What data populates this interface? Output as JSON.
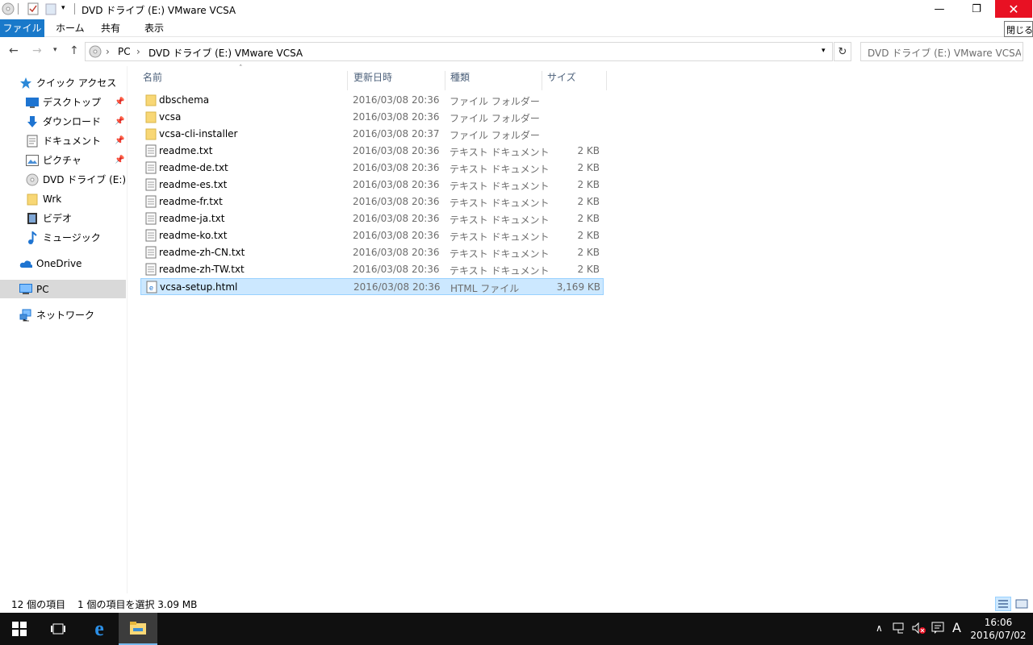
{
  "window": {
    "title": "DVD ドライブ (E:) VMware VCSA",
    "close_tooltip": "閉じる",
    "minimize_glyph": "—",
    "restore_glyph": "❐",
    "close_glyph": "✕"
  },
  "ribbon": {
    "tabs": [
      "ファイル",
      "ホーム",
      "共有",
      "表示"
    ]
  },
  "address": {
    "crumbs": [
      "PC",
      "DVD ドライブ (E:) VMware VCSA"
    ]
  },
  "search": {
    "placeholder": "DVD ドライブ (E:) VMware VCSA..."
  },
  "sidebar": {
    "items": [
      {
        "label": "クイック アクセス",
        "icon": "star-icon"
      },
      {
        "label": "デスクトップ",
        "icon": "desktop-icon",
        "pinned": true
      },
      {
        "label": "ダウンロード",
        "icon": "download-icon",
        "pinned": true
      },
      {
        "label": "ドキュメント",
        "icon": "document-icon",
        "pinned": true
      },
      {
        "label": "ピクチャ",
        "icon": "picture-icon",
        "pinned": true
      },
      {
        "label": "DVD ドライブ (E:) VMware VCSA",
        "icon": "dvd-icon"
      },
      {
        "label": "Wrk",
        "icon": "folder-icon"
      },
      {
        "label": "ビデオ",
        "icon": "video-icon"
      },
      {
        "label": "ミュージック",
        "icon": "music-icon"
      },
      {
        "label": "OneDrive",
        "icon": "cloud-icon"
      },
      {
        "label": "PC",
        "icon": "pc-icon",
        "selected": true
      },
      {
        "label": "ネットワーク",
        "icon": "network-icon"
      }
    ]
  },
  "columns": [
    "名前",
    "更新日時",
    "種類",
    "サイズ"
  ],
  "files": [
    {
      "name": "dbschema",
      "date": "2016/03/08 20:36",
      "type": "ファイル フォルダー",
      "size": "",
      "kind": "folder"
    },
    {
      "name": "vcsa",
      "date": "2016/03/08 20:36",
      "type": "ファイル フォルダー",
      "size": "",
      "kind": "folder"
    },
    {
      "name": "vcsa-cli-installer",
      "date": "2016/03/08 20:37",
      "type": "ファイル フォルダー",
      "size": "",
      "kind": "folder"
    },
    {
      "name": "readme.txt",
      "date": "2016/03/08 20:36",
      "type": "テキスト ドキュメント",
      "size": "2 KB",
      "kind": "txt"
    },
    {
      "name": "readme-de.txt",
      "date": "2016/03/08 20:36",
      "type": "テキスト ドキュメント",
      "size": "2 KB",
      "kind": "txt"
    },
    {
      "name": "readme-es.txt",
      "date": "2016/03/08 20:36",
      "type": "テキスト ドキュメント",
      "size": "2 KB",
      "kind": "txt"
    },
    {
      "name": "readme-fr.txt",
      "date": "2016/03/08 20:36",
      "type": "テキスト ドキュメント",
      "size": "2 KB",
      "kind": "txt"
    },
    {
      "name": "readme-ja.txt",
      "date": "2016/03/08 20:36",
      "type": "テキスト ドキュメント",
      "size": "2 KB",
      "kind": "txt"
    },
    {
      "name": "readme-ko.txt",
      "date": "2016/03/08 20:36",
      "type": "テキスト ドキュメント",
      "size": "2 KB",
      "kind": "txt"
    },
    {
      "name": "readme-zh-CN.txt",
      "date": "2016/03/08 20:36",
      "type": "テキスト ドキュメント",
      "size": "2 KB",
      "kind": "txt"
    },
    {
      "name": "readme-zh-TW.txt",
      "date": "2016/03/08 20:36",
      "type": "テキスト ドキュメント",
      "size": "2 KB",
      "kind": "txt"
    },
    {
      "name": "vcsa-setup.html",
      "date": "2016/03/08 20:36",
      "type": "HTML ファイル",
      "size": "3,169 KB",
      "kind": "html",
      "selected": true
    }
  ],
  "status": {
    "item_count": "12 個の項目",
    "selection": "1 個の項目を選択  3.09 MB"
  },
  "taskbar": {
    "ime": "A",
    "time": "16:06",
    "date": "2016/07/02"
  },
  "colors": {
    "accent": "#1979ca",
    "selection_bg": "#cce8ff",
    "selection_border": "#99d1ff",
    "close_red": "#e81123",
    "folder": "#f8d775"
  }
}
